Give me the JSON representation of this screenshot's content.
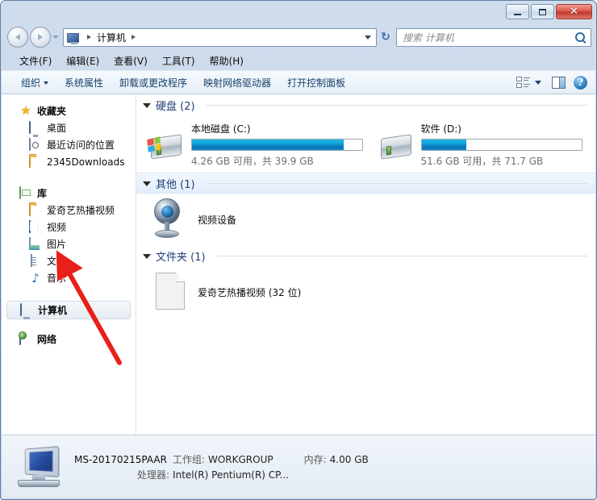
{
  "window": {
    "controls": {
      "minimize": "–",
      "maximize": "▭",
      "close": "✕"
    }
  },
  "address": {
    "crumb_root": "计算机",
    "refresh_glyph": "↻"
  },
  "search": {
    "placeholder": "搜索 计算机"
  },
  "menubar": {
    "items": [
      {
        "label": "文件(F)"
      },
      {
        "label": "编辑(E)"
      },
      {
        "label": "查看(V)"
      },
      {
        "label": "工具(T)"
      },
      {
        "label": "帮助(H)"
      }
    ]
  },
  "commandbar": {
    "organize": "组织",
    "items": [
      {
        "label": "系统属性"
      },
      {
        "label": "卸载或更改程序"
      },
      {
        "label": "映射网络驱动器"
      },
      {
        "label": "打开控制面板"
      }
    ],
    "help_glyph": "?"
  },
  "sidebar": {
    "favorites": {
      "label": "收藏夹",
      "children": [
        {
          "label": "桌面",
          "icon": "desktop-icon"
        },
        {
          "label": "最近访问的位置",
          "icon": "recent-places-icon"
        },
        {
          "label": "2345Downloads",
          "icon": "folder-icon"
        }
      ]
    },
    "libraries": {
      "label": "库",
      "children": [
        {
          "label": "爱奇艺热播视频",
          "icon": "folder-icon"
        },
        {
          "label": "视频",
          "icon": "video-icon"
        },
        {
          "label": "图片",
          "icon": "picture-icon"
        },
        {
          "label": "文档",
          "icon": "document-icon"
        },
        {
          "label": "音乐",
          "icon": "music-icon"
        }
      ]
    },
    "computer": {
      "label": "计算机"
    },
    "network": {
      "label": "网络"
    }
  },
  "content": {
    "groups": [
      {
        "title": "硬盘 (2)",
        "highlight": false,
        "drives": [
          {
            "name": "本地磁盘 (C:)",
            "free_text": "4.26 GB 可用，共 39.9 GB",
            "free_gb": 4.26,
            "total_gb": 39.9,
            "used_percent": 89,
            "icon": "system-drive-icon"
          },
          {
            "name": "软件 (D:)",
            "free_text": "51.6 GB 可用，共 71.7 GB",
            "free_gb": 51.6,
            "total_gb": 71.7,
            "used_percent": 28,
            "icon": "drive-icon"
          }
        ]
      },
      {
        "title": "其他 (1)",
        "highlight": true,
        "items": [
          {
            "label": "视频设备",
            "icon": "webcam-icon"
          }
        ]
      },
      {
        "title": "文件夹 (1)",
        "highlight": false,
        "items": [
          {
            "label": "爱奇艺热播视频 (32 位)",
            "icon": "file-icon"
          }
        ]
      }
    ]
  },
  "statusbar": {
    "computer_name": "MS-20170215PAAR",
    "workgroup_key": "工作组:",
    "workgroup_value": "WORKGROUP",
    "memory_key": "内存:",
    "memory_value": "4.00 GB",
    "processor_key": "处理器:",
    "processor_value": "Intel(R) Pentium(R) CP..."
  },
  "annotation": {
    "color": "#e8201a",
    "type": "arrow",
    "points_to": "文档"
  }
}
